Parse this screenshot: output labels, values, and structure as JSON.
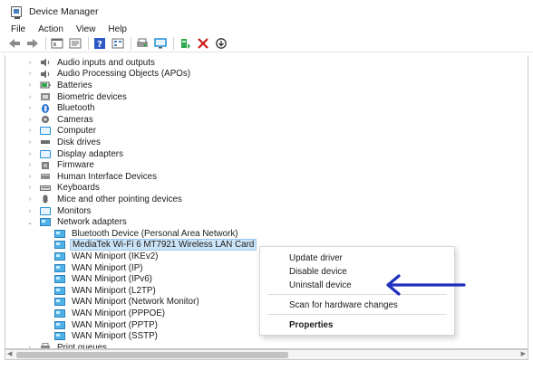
{
  "window": {
    "title": "Device Manager"
  },
  "menu": [
    "File",
    "Action",
    "View",
    "Help"
  ],
  "toolbar_icons": [
    "back-icon",
    "forward-icon",
    "console-tree-icon",
    "properties-icon",
    "help-icon",
    "view-icon",
    "print-icon",
    "monitor-icon",
    "update-driver-icon",
    "uninstall-icon",
    "download-icon"
  ],
  "tree": [
    {
      "label": "Audio inputs and outputs",
      "icon": "speaker-icon",
      "level": 0,
      "expander": "›"
    },
    {
      "label": "Audio Processing Objects (APOs)",
      "icon": "speaker-icon",
      "level": 0,
      "expander": "›"
    },
    {
      "label": "Batteries",
      "icon": "battery-icon",
      "level": 0,
      "expander": "›"
    },
    {
      "label": "Biometric devices",
      "icon": "fingerprint-icon",
      "level": 0,
      "expander": "›"
    },
    {
      "label": "Bluetooth",
      "icon": "bluetooth-icon",
      "level": 0,
      "expander": "›"
    },
    {
      "label": "Cameras",
      "icon": "camera-icon",
      "level": 0,
      "expander": "›"
    },
    {
      "label": "Computer",
      "icon": "monitor-icon",
      "level": 0,
      "expander": "›"
    },
    {
      "label": "Disk drives",
      "icon": "disk-drive-icon",
      "level": 0,
      "expander": "›"
    },
    {
      "label": "Display adapters",
      "icon": "monitor-icon",
      "level": 0,
      "expander": "›"
    },
    {
      "label": "Firmware",
      "icon": "chip-icon",
      "level": 0,
      "expander": "›"
    },
    {
      "label": "Human Interface Devices",
      "icon": "hid-icon",
      "level": 0,
      "expander": "›"
    },
    {
      "label": "Keyboards",
      "icon": "keyboard-icon",
      "level": 0,
      "expander": "›"
    },
    {
      "label": "Mice and other pointing devices",
      "icon": "mouse-icon",
      "level": 0,
      "expander": "›"
    },
    {
      "label": "Monitors",
      "icon": "monitor-icon",
      "level": 0,
      "expander": "›"
    },
    {
      "label": "Network adapters",
      "icon": "network-adapter-icon",
      "level": 0,
      "expander": "⌄"
    },
    {
      "label": "Bluetooth Device (Personal Area Network)",
      "icon": "network-adapter-icon",
      "level": 1,
      "expander": ""
    },
    {
      "label": "MediaTek Wi-Fi 6 MT7921 Wireless LAN Card",
      "icon": "network-adapter-icon",
      "level": 1,
      "expander": "",
      "selected": true
    },
    {
      "label": "WAN Miniport (IKEv2)",
      "icon": "network-adapter-icon",
      "level": 1,
      "expander": ""
    },
    {
      "label": "WAN Miniport (IP)",
      "icon": "network-adapter-icon",
      "level": 1,
      "expander": ""
    },
    {
      "label": "WAN Miniport (IPv6)",
      "icon": "network-adapter-icon",
      "level": 1,
      "expander": ""
    },
    {
      "label": "WAN Miniport (L2TP)",
      "icon": "network-adapter-icon",
      "level": 1,
      "expander": ""
    },
    {
      "label": "WAN Miniport (Network Monitor)",
      "icon": "network-adapter-icon",
      "level": 1,
      "expander": ""
    },
    {
      "label": "WAN Miniport (PPPOE)",
      "icon": "network-adapter-icon",
      "level": 1,
      "expander": ""
    },
    {
      "label": "WAN Miniport (PPTP)",
      "icon": "network-adapter-icon",
      "level": 1,
      "expander": ""
    },
    {
      "label": "WAN Miniport (SSTP)",
      "icon": "network-adapter-icon",
      "level": 1,
      "expander": ""
    },
    {
      "label": "Print queues",
      "icon": "printer-icon",
      "level": 0,
      "expander": "›"
    }
  ],
  "context_menu": {
    "update_driver": "Update driver",
    "disable_device": "Disable device",
    "uninstall_device": "Uninstall device",
    "scan_hardware": "Scan for hardware changes",
    "properties": "Properties"
  },
  "colors": {
    "selection_bg": "#cce4f7",
    "selection_border": "#99c9ef",
    "annotation_arrow": "#1f2fbf"
  }
}
